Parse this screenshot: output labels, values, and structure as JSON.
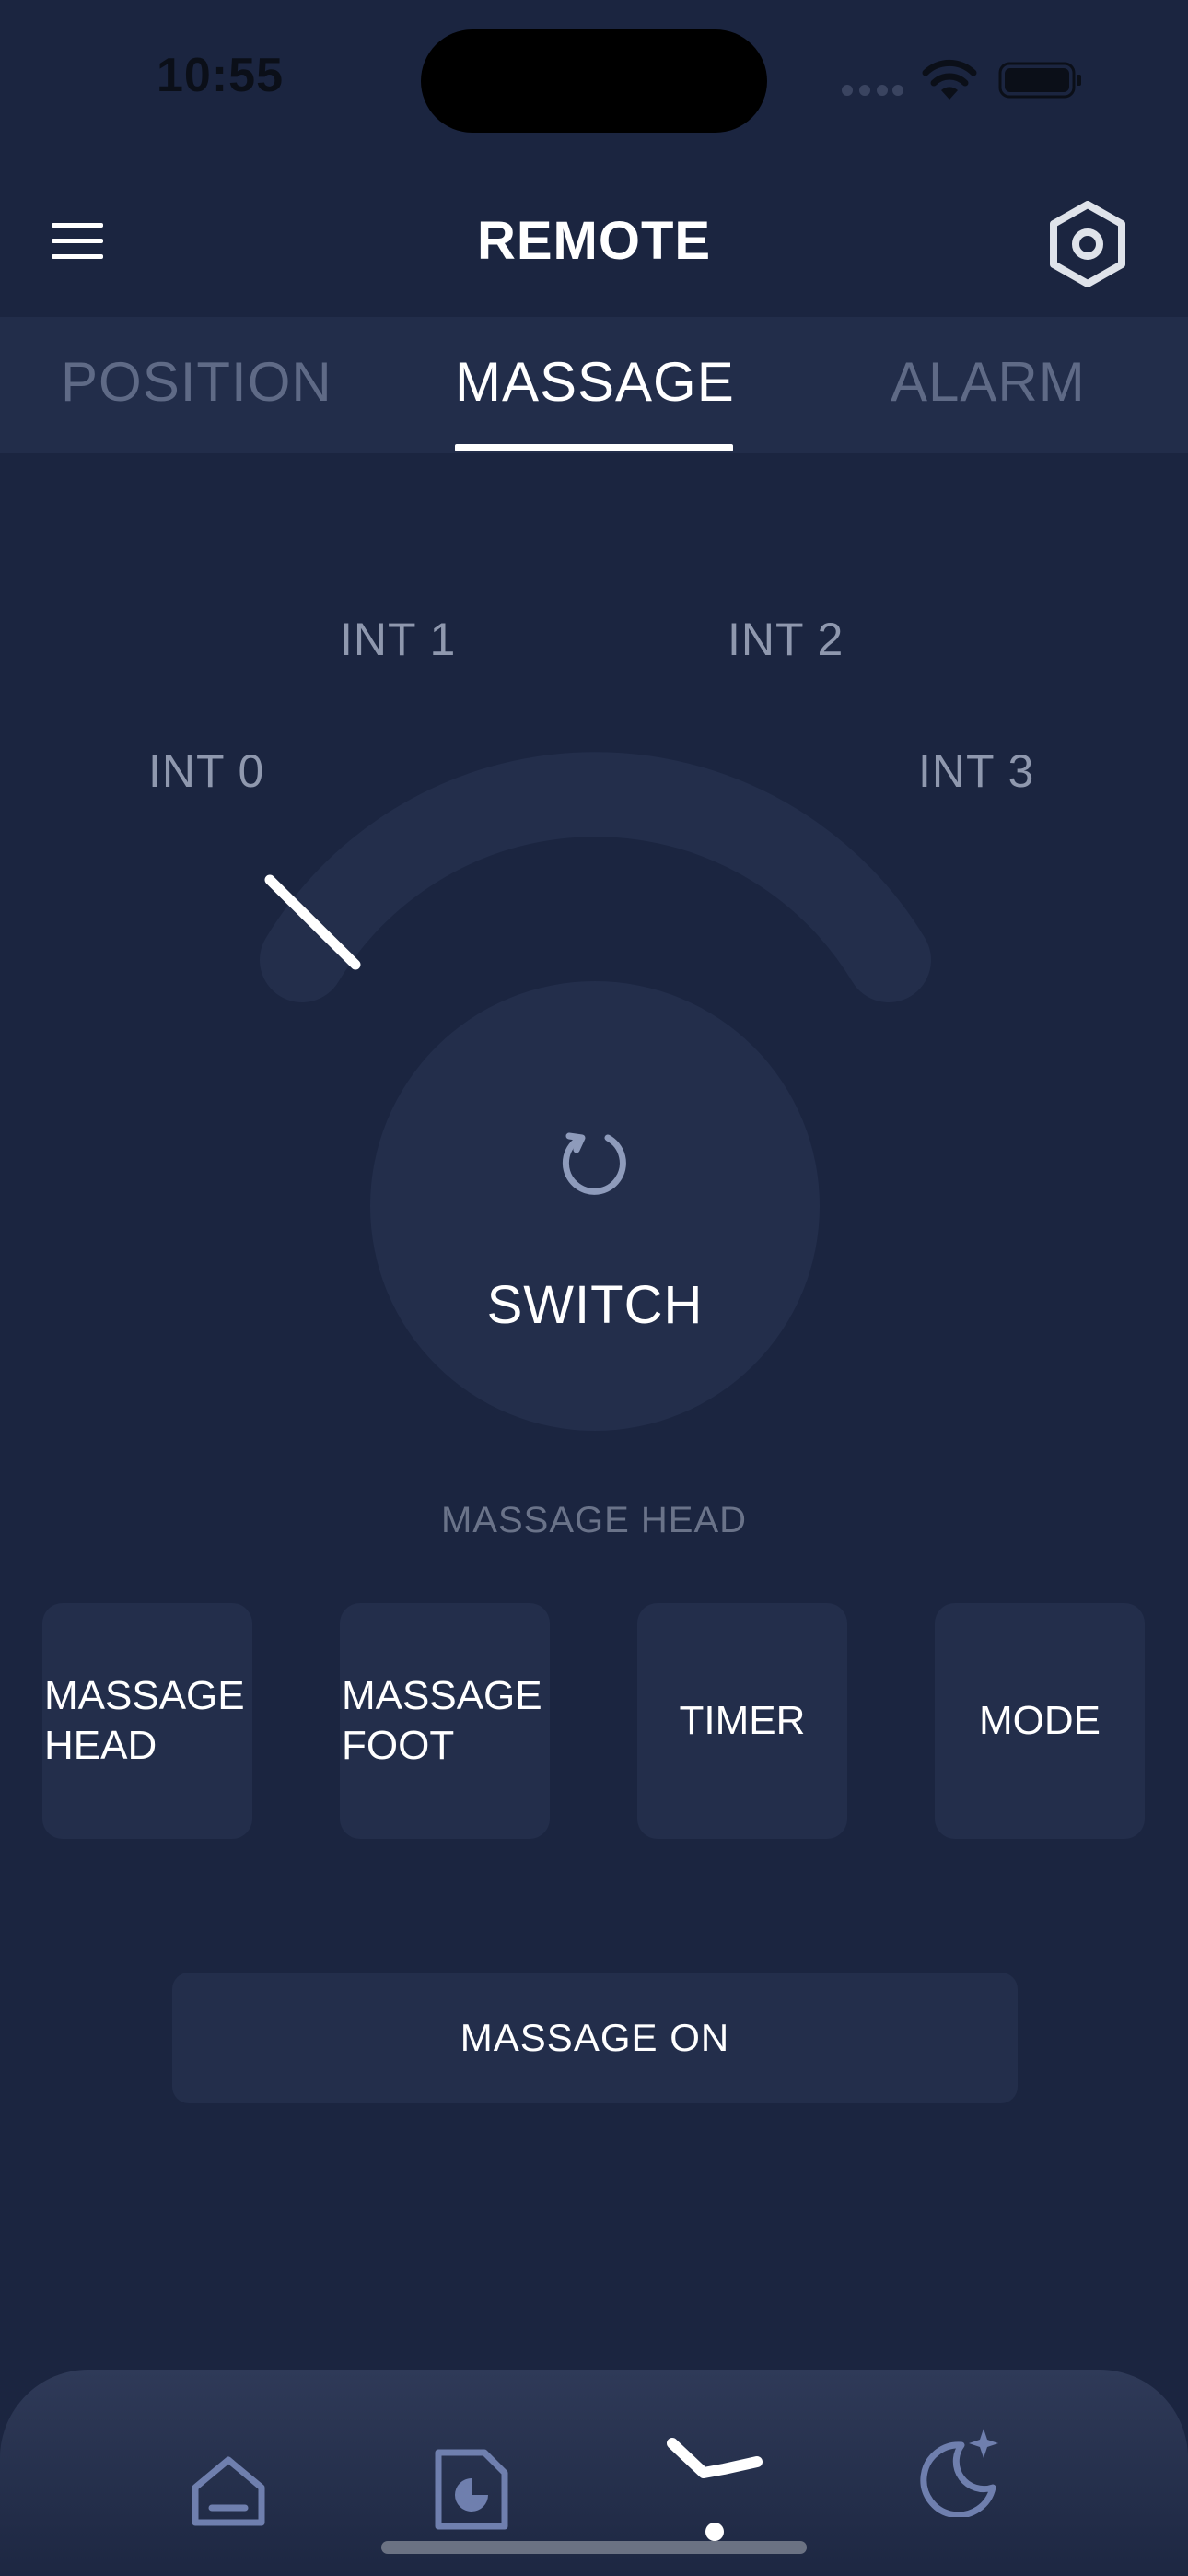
{
  "status_bar": {
    "time": "10:55",
    "cell_icon": "cellular-signal-icon",
    "wifi_icon": "wifi-icon",
    "battery_icon": "battery-icon"
  },
  "header": {
    "title": "REMOTE",
    "menu_icon": "hamburger-menu-icon",
    "settings_icon": "hexagon-settings-icon"
  },
  "tabs": [
    {
      "label": "POSITION",
      "active": false
    },
    {
      "label": "MASSAGE",
      "active": true
    },
    {
      "label": "ALARM",
      "active": false
    }
  ],
  "dial": {
    "labels": [
      "INT 0",
      "INT 1",
      "INT 2",
      "INT 3"
    ],
    "selected_level": 0
  },
  "switch": {
    "label": "SWITCH",
    "icon": "refresh-icon"
  },
  "section_label": "MASSAGE HEAD",
  "buttons": {
    "massage_head": "MASSAGE\nHEAD",
    "massage_foot": "MASSAGE\nFOOT",
    "timer": "TIMER",
    "mode": "MODE"
  },
  "massage_on": "MASSAGE ON",
  "bottom_nav": {
    "items": [
      "home-icon",
      "report-icon",
      "bed-remote-icon",
      "sleep-moon-icon"
    ],
    "active_index": 2
  },
  "colors": {
    "background": "#1b2540",
    "surface": "#232e4b",
    "tab_bar": "#222d4a",
    "inactive_text": "#5f6a86",
    "nav_icon": "#6f7fae"
  }
}
